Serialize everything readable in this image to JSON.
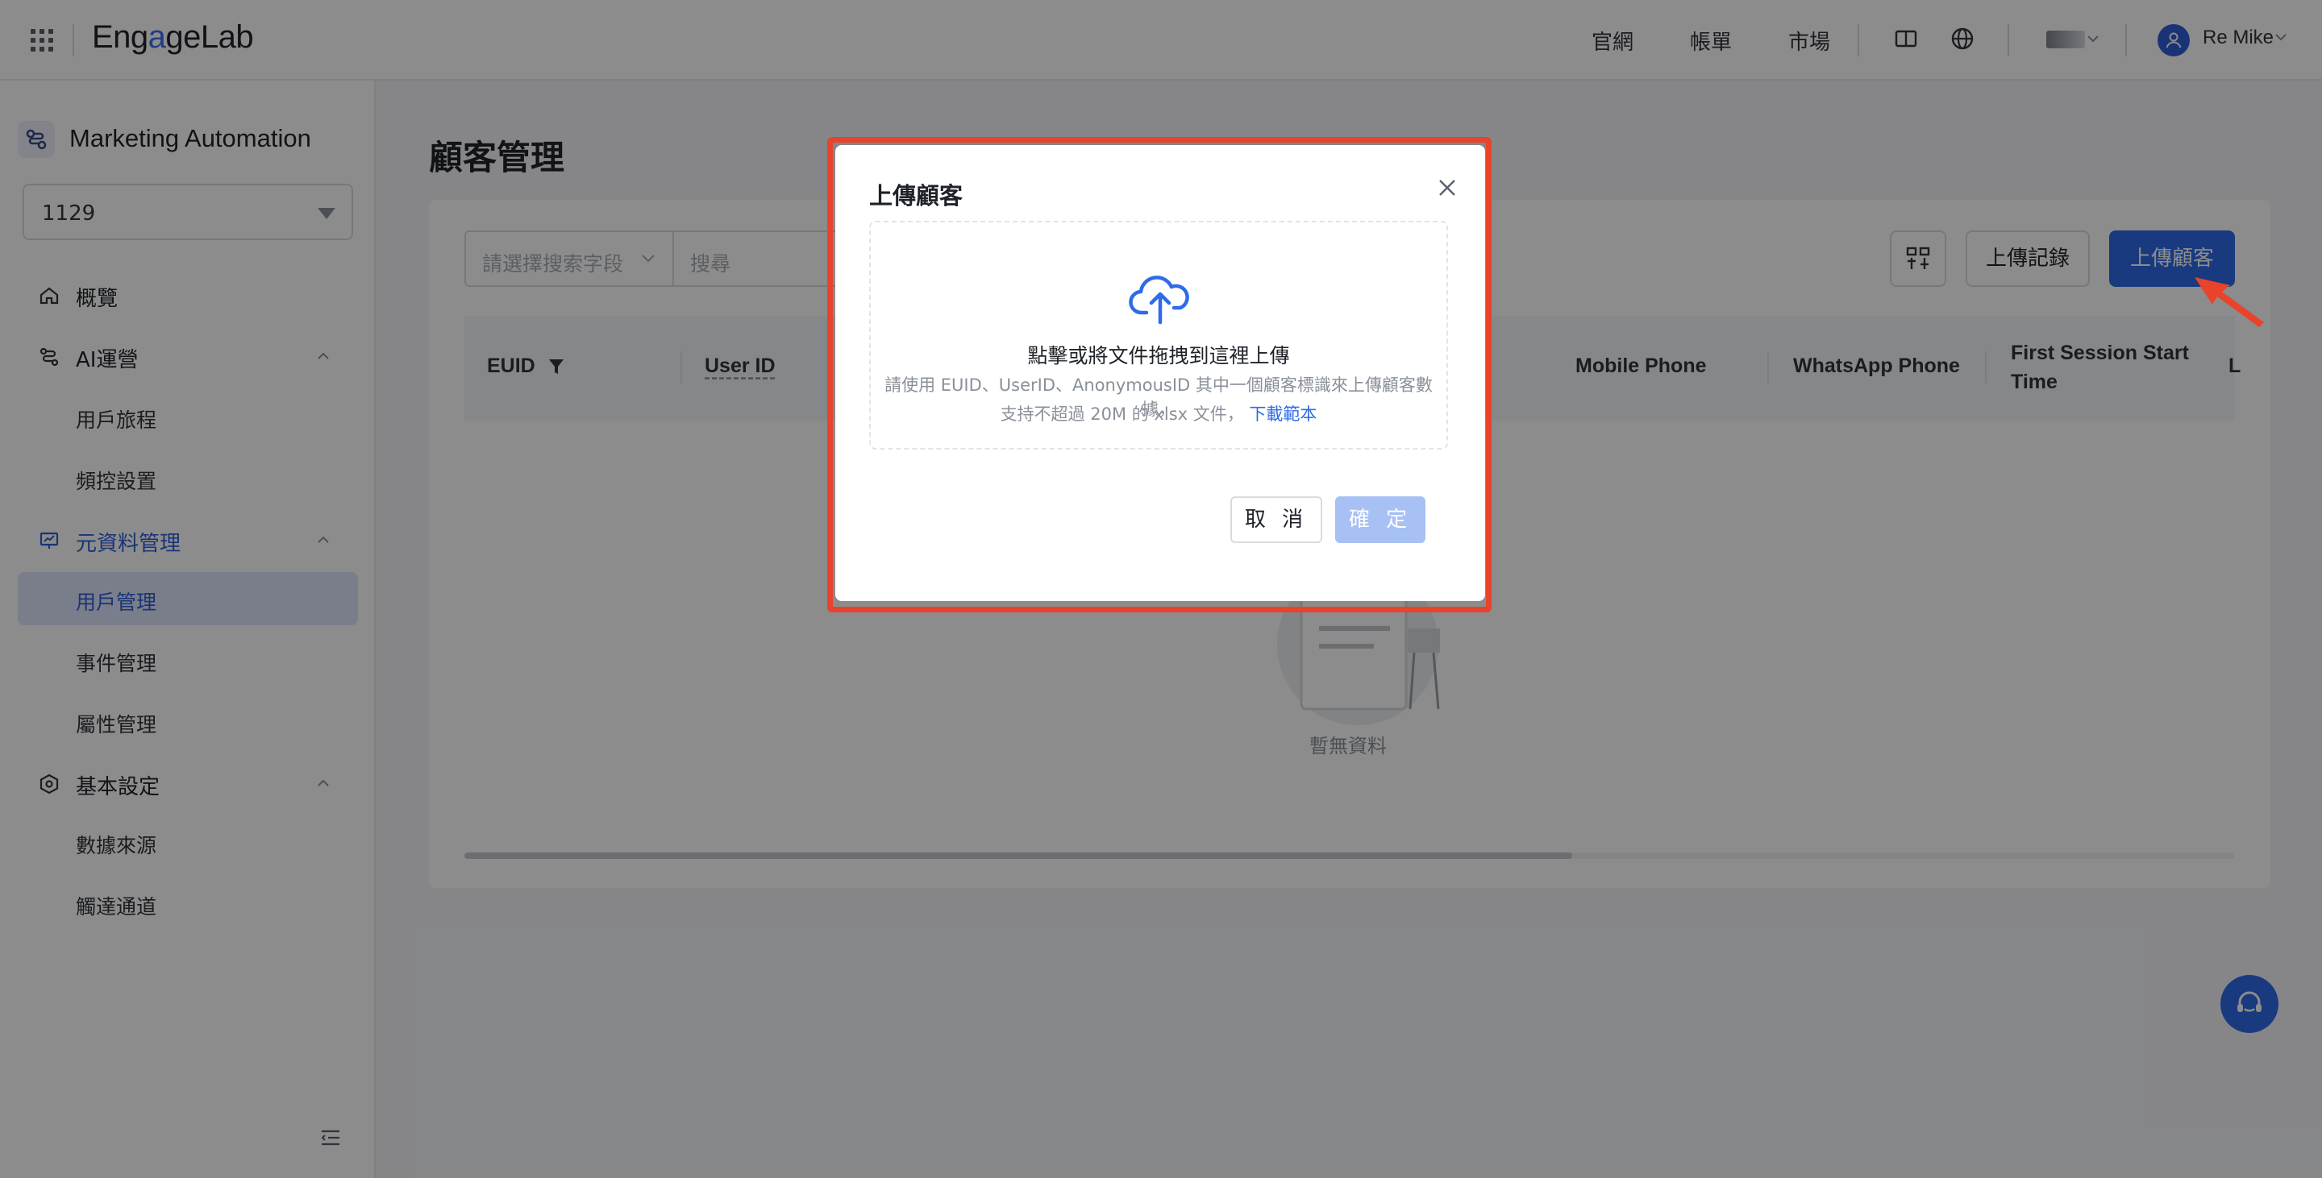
{
  "topbar": {
    "logo_part1": "Eng",
    "logo_part2": "a",
    "logo_part3": "geLab",
    "links": [
      "官網",
      "帳單",
      "市場"
    ],
    "user_name": "Re Mike"
  },
  "sidebar": {
    "product_title": "Marketing Automation",
    "project_value": "1129",
    "items": [
      {
        "label": "概覽",
        "type": "item"
      },
      {
        "label": "AI運營",
        "type": "group"
      },
      {
        "label": "用戶旅程",
        "type": "sub"
      },
      {
        "label": "頻控設置",
        "type": "sub"
      },
      {
        "label": "元資料管理",
        "type": "group",
        "active": true
      },
      {
        "label": "用戶管理",
        "type": "sub",
        "active": true
      },
      {
        "label": "事件管理",
        "type": "sub"
      },
      {
        "label": "屬性管理",
        "type": "sub"
      },
      {
        "label": "基本設定",
        "type": "group"
      },
      {
        "label": "數據來源",
        "type": "sub"
      },
      {
        "label": "觸達通道",
        "type": "sub"
      }
    ]
  },
  "main": {
    "page_title": "顧客管理",
    "search_field_placeholder": "請選擇搜索字段",
    "search_placeholder": "搜尋",
    "btn_records": "上傳記錄",
    "btn_upload": "上傳顧客",
    "columns": [
      "EUID",
      "User ID",
      "Mobile Phone",
      "WhatsApp Phone",
      "First Session Start",
      "Time",
      "L"
    ],
    "empty_text": "暫無資料"
  },
  "modal": {
    "title": "上傳顧客",
    "drop_main": "點擊或將文件拖拽到這裡上傳",
    "hint_line1": "請使用 EUID、UserID、AnonymousID 其中一個顧客標識來上傳顧客數據，",
    "hint_line2_prefix": "支持不超過 20M 的 xlsx 文件，",
    "download_link": "下載範本",
    "cancel": "取 消",
    "ok": "確 定"
  },
  "colors": {
    "primary": "#2f6be8",
    "highlight": "#e8432b",
    "ok_disabled": "#a7c1f5"
  }
}
